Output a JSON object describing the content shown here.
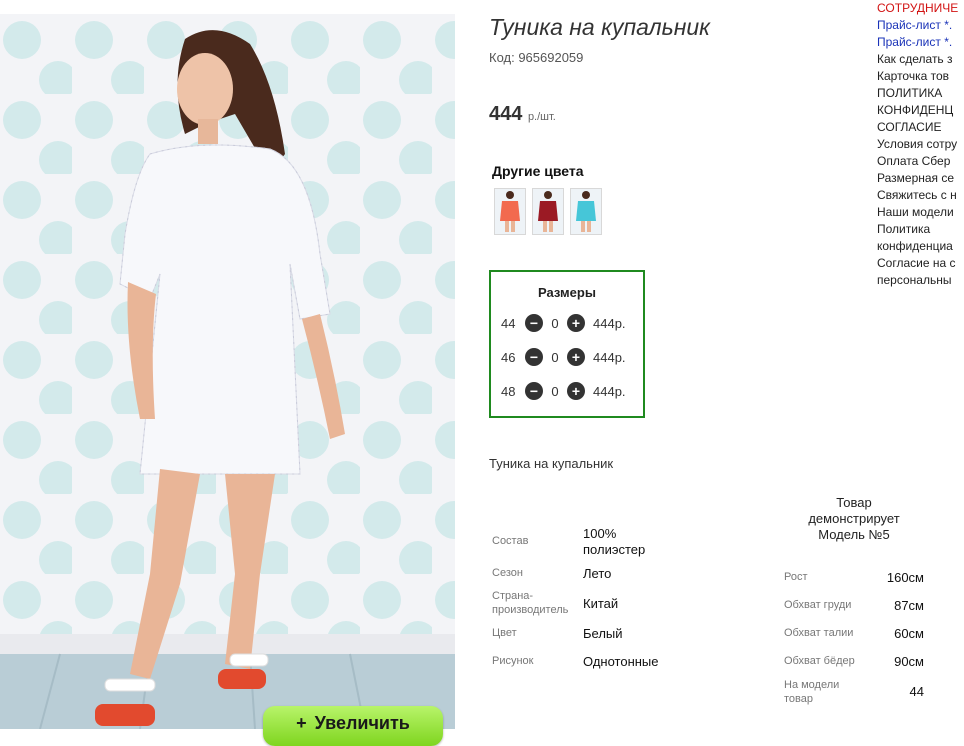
{
  "product": {
    "title": "Туника на купальник",
    "code": "Код: 965692059",
    "price": "444",
    "price_unit": "р./шт.",
    "zoom_label": "Увеличить",
    "colors_title": "Другие цвета",
    "swatches": [
      "coral",
      "burgundy",
      "turquoise"
    ],
    "description": "Туника на купальник"
  },
  "sizes": {
    "title": "Размеры",
    "rows": [
      {
        "size": "44",
        "qty": "0",
        "price": "444р."
      },
      {
        "size": "46",
        "qty": "0",
        "price": "444р."
      },
      {
        "size": "48",
        "qty": "0",
        "price": "444р."
      }
    ]
  },
  "specs": [
    {
      "label": "Состав",
      "value": "100% полиэстер"
    },
    {
      "label": "Сезон",
      "value": "Лето"
    },
    {
      "label": "Страна-производитель",
      "value": "Китай"
    },
    {
      "label": "Цвет",
      "value": "Белый"
    },
    {
      "label": "Рисунок",
      "value": "Однотонные"
    }
  ],
  "model": {
    "heading": "Товар демонстрирует Модель №5",
    "rows": [
      {
        "label": "Рост",
        "value": "160см"
      },
      {
        "label": "Обхват груди",
        "value": "87см"
      },
      {
        "label": "Обхват талии",
        "value": "60см"
      },
      {
        "label": "Обхват бёдер",
        "value": "90см"
      },
      {
        "label": "На модели товар",
        "value": "44"
      }
    ]
  },
  "nav": [
    {
      "text": "СОТРУДНИЧЕ",
      "style": "red"
    },
    {
      "text": "Прайс-лист *.",
      "style": "blue"
    },
    {
      "text": "Прайс-лист *.",
      "style": "blue"
    },
    {
      "text": "Как сделать з",
      "style": "plain"
    },
    {
      "text": "Карточка тов",
      "style": "plain"
    },
    {
      "text": "ПОЛИТИКА",
      "style": "plain"
    },
    {
      "text": "КОНФИДЕНЦ",
      "style": "plain"
    },
    {
      "text": "СОГЛАСИЕ",
      "style": "plain"
    },
    {
      "text": "Условия сотру",
      "style": "plain"
    },
    {
      "text": "Оплата Сбер",
      "style": "plain"
    },
    {
      "text": "Размерная се",
      "style": "plain"
    },
    {
      "text": "Свяжитесь с н",
      "style": "plain"
    },
    {
      "text": "Наши модели",
      "style": "plain"
    },
    {
      "text": "Политика",
      "style": "plain"
    },
    {
      "text": "конфиденциа",
      "style": "plain"
    },
    {
      "text": "Согласие на с",
      "style": "plain"
    },
    {
      "text": "персональны",
      "style": "plain"
    }
  ],
  "colors": {
    "accent_green": "#1f8a1f",
    "zoom_button": "#8fe03a",
    "nav_red": "#d21313",
    "nav_blue": "#1a33b8"
  }
}
